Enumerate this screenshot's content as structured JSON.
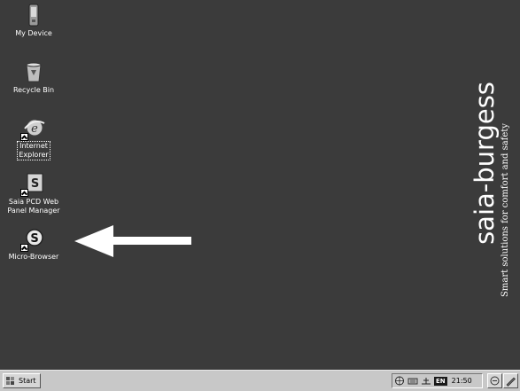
{
  "desktop": {
    "icons": [
      {
        "label": "My Device",
        "icon": "pda-device-icon"
      },
      {
        "label": "Recycle Bin",
        "icon": "recycle-bin-icon"
      },
      {
        "label": "Internet\nExplorer",
        "icon": "internet-explorer-icon"
      },
      {
        "label": "Saia PCD Web\nPanel Manager",
        "icon": "saia-web-panel-icon"
      },
      {
        "label": "Micro-Browser",
        "icon": "micro-browser-icon"
      }
    ],
    "annotation": "arrow pointing left toward Micro-Browser icon"
  },
  "brand": {
    "logo_text": "saia-burgess",
    "tagline": "Smart solutions for comfort and safety"
  },
  "taskbar": {
    "start_label": "Start",
    "language": "EN",
    "clock": "21:50"
  },
  "colors": {
    "desktop": "#3b3b3b",
    "taskbar": "#c8c8c8",
    "text": "#ffffff"
  }
}
